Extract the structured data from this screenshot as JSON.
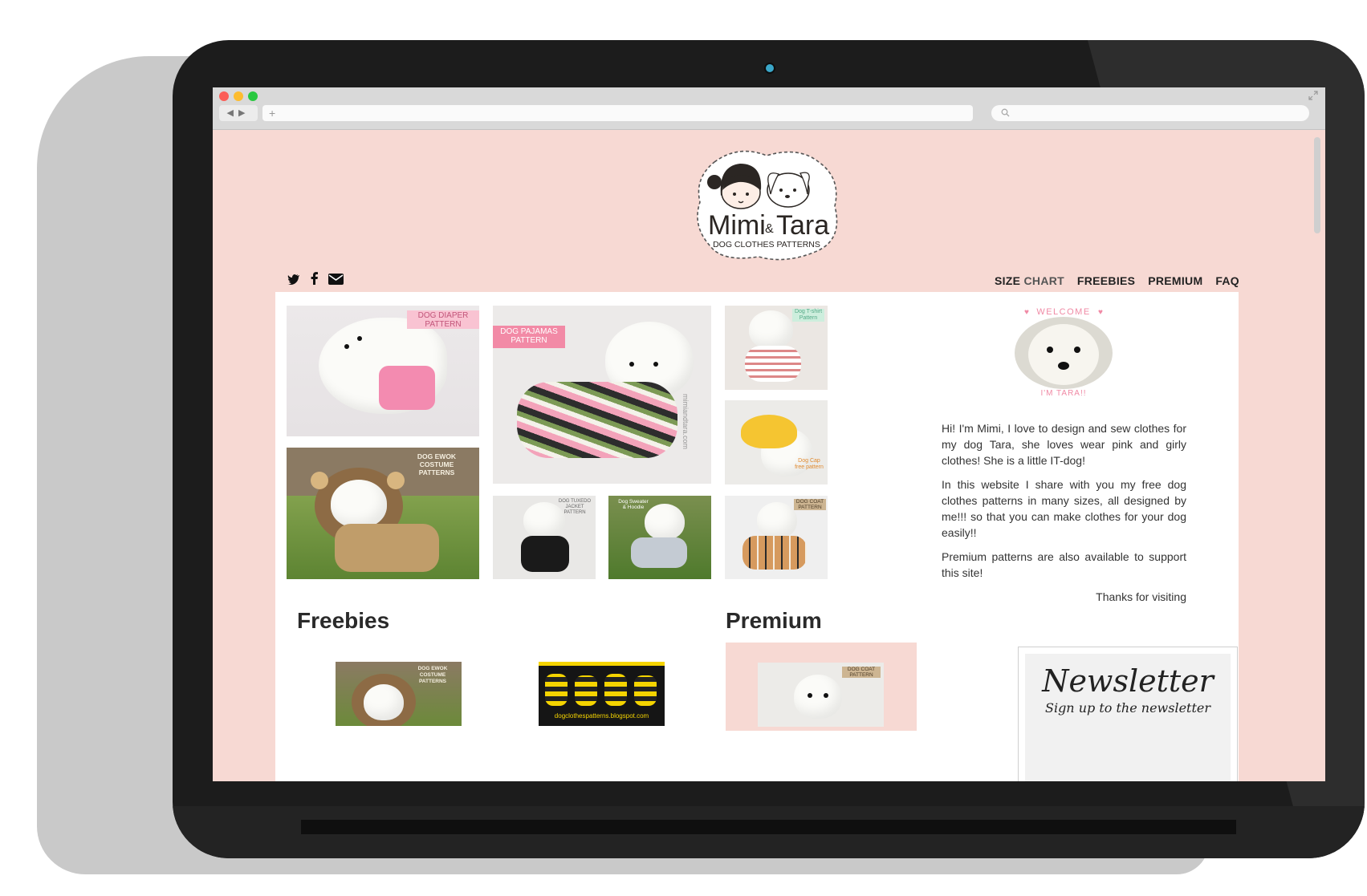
{
  "browser": {
    "url": "+",
    "search_icon": "search-icon",
    "nav_back": "◀",
    "nav_forward": "▶",
    "expand_icon": "expand-icon"
  },
  "site": {
    "logo": {
      "line1": "Mimi",
      "amp": "&",
      "line2": "Tara",
      "subtitle": "DOG CLOTHES PATTERNS"
    },
    "social": [
      "twitter-icon",
      "facebook-icon",
      "mail-icon"
    ],
    "nav": {
      "size_bold": "SIZE",
      "size_light": "CHART",
      "freebies": "FREEBIES",
      "premium": "PREMIUM",
      "faq": "FAQ"
    }
  },
  "gallery": {
    "diaper_tag": "DOG DIAPER\nPATTERN",
    "pajamas_tag": "DOG PAJAMAS\nPATTERN",
    "ewok_tag": "DOG EWOK COSTUME\nPATTERNS",
    "pajamas_watermark": "mimiandtara.com",
    "small_tags": [
      "Dog T-shirt\nPattern",
      "Dog Cap\nfree pattern",
      "DOG TUXEDO\nJACKET PATTERN",
      "Dog Sweater\n& Hoodie",
      "DOG COAT\nPATTERN"
    ]
  },
  "about": {
    "welcome": "WELCOME",
    "im_tara": "I'M TARA!!",
    "p1": "Hi! I'm Mimi, I love to design and sew clothes for my dog Tara, she loves wear pink and girly clothes! She is a little IT-dog!",
    "p2": "In this website I share with you my free dog clothes patterns in many sizes, all designed by me!!! so that you can make clothes for your dog easily!!",
    "p3": "Premium patterns are also available to support this site!",
    "thanks": "Thanks for visiting"
  },
  "sections": {
    "freebies": "Freebies",
    "premium": "Premium",
    "freebie1_tag": "DOG EWOK COSTUME\nPATTERNS",
    "freebie2_caption": "dogclothespatterns.blogspot.com",
    "premium1_tag": "DOG COAT\nPATTERN"
  },
  "newsletter": {
    "title": "Newsletter",
    "subtitle": "Sign up to the newsletter"
  },
  "colors": {
    "page_bg": "#f7d9d3",
    "accent_pink": "#f49db1",
    "laptop": "#1c1c1c"
  }
}
